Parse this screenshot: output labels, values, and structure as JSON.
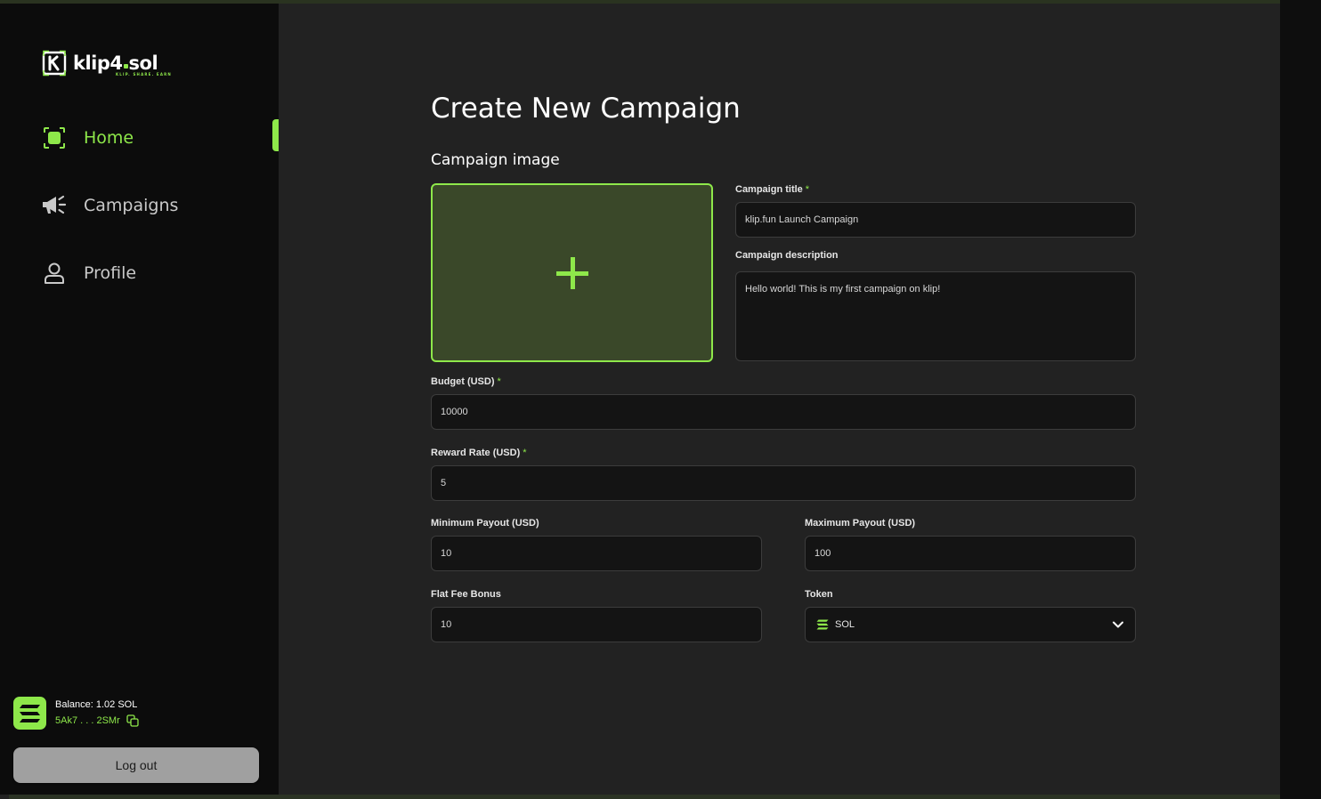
{
  "app": {
    "logo_text_a": "klip",
    "logo_text_b": "4",
    "logo_text_c": "sol",
    "logo_tagline": "KLIP. SHARE. EARN"
  },
  "sidebar": {
    "items": [
      {
        "label": "Home",
        "icon": "home-icon",
        "active": true
      },
      {
        "label": "Campaigns",
        "icon": "megaphone-icon",
        "active": false
      },
      {
        "label": "Profile",
        "icon": "user-icon",
        "active": false
      }
    ],
    "wallet": {
      "balance": "Balance: 1.02 SOL",
      "address": "5Ak7 . . . 2SMr"
    },
    "logout_label": "Log out"
  },
  "main": {
    "title": "Create New Campaign",
    "image_section_label": "Campaign image",
    "fields": {
      "title": {
        "label": "Campaign title",
        "value": "klip.fun Launch Campaign"
      },
      "description": {
        "label": "Campaign description",
        "value": "Hello world! This is my first campaign on klip!"
      },
      "budget": {
        "label": "Budget (USD)",
        "value": "10000"
      },
      "reward_rate": {
        "label": "Reward Rate (USD)",
        "value": "5"
      },
      "min_payout": {
        "label": "Minimum Payout (USD)",
        "value": "10"
      },
      "max_payout": {
        "label": "Maximum Payout (USD)",
        "value": "100"
      },
      "flat_fee": {
        "label": "Flat Fee Bonus",
        "value": "10"
      },
      "token": {
        "label": "Token",
        "value": "SOL"
      }
    },
    "required_mark": "*"
  },
  "colors": {
    "accent": "#8ee84a",
    "sidebar_bg": "#0c0c0c",
    "main_bg": "#222222",
    "input_bg": "#141414",
    "image_drop_bg": "#3a4829"
  }
}
